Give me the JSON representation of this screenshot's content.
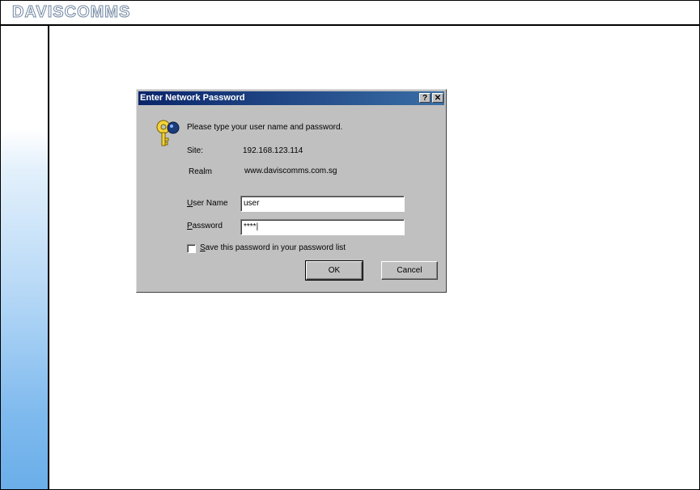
{
  "brand": {
    "logo_text": "DAVISCOMMS"
  },
  "dialog": {
    "title": "Enter Network Password",
    "help_button": "?",
    "close_button": "✕",
    "prompt": "Please type your user name and password.",
    "site_label": "Site:",
    "site_value": "192.168.123.114",
    "realm_label": "Realm",
    "realm_value": "www.daviscomms.com.sg",
    "username_label_u": "U",
    "username_label_rest": "ser Name",
    "username_value": "user",
    "password_label_p": "P",
    "password_label_rest": "assword",
    "password_value": "****|",
    "save_label_s": "S",
    "save_label_rest": "ave this password in your password list",
    "save_checked": false,
    "ok_label": "OK",
    "cancel_label": "Cancel"
  },
  "colors": {
    "title_bar_start": "#0a246a",
    "title_bar_end": "#3a6ea5",
    "dialog_face": "#c0c0c0",
    "sidebar_gradient_end": "#6aaee9"
  }
}
